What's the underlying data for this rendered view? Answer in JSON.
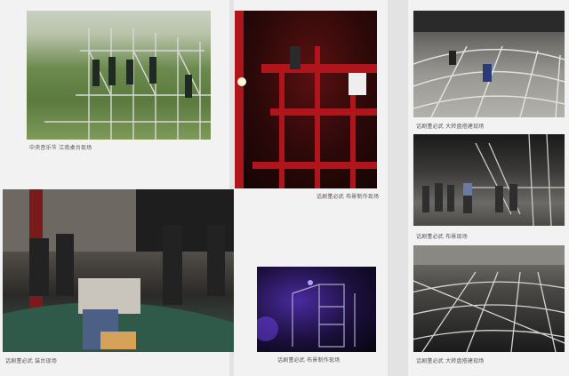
{
  "captions": {
    "c1": "中央音乐节  江南桌台现场",
    "c2": "话剧董必武  布景制作现场",
    "c3": "话剧董必武  大转盘搭建现场",
    "c4": "话剧董必武  布景现场",
    "c5": "话剧董必武  装台现场",
    "c6": "话剧董必武  布景制作现场",
    "c7": "话剧董必武  大转盘搭建现场"
  },
  "photos": {
    "p1": "scaffold-trees-photo",
    "p2": "red-stage-structure-photo",
    "p3": "turntable-frame-photo",
    "p4": "backstage-crew-photo",
    "p5": "stage-setup-workers-photo",
    "p6": "purple-lit-scaffold-photo",
    "p7": "turntable-grid-photo"
  }
}
